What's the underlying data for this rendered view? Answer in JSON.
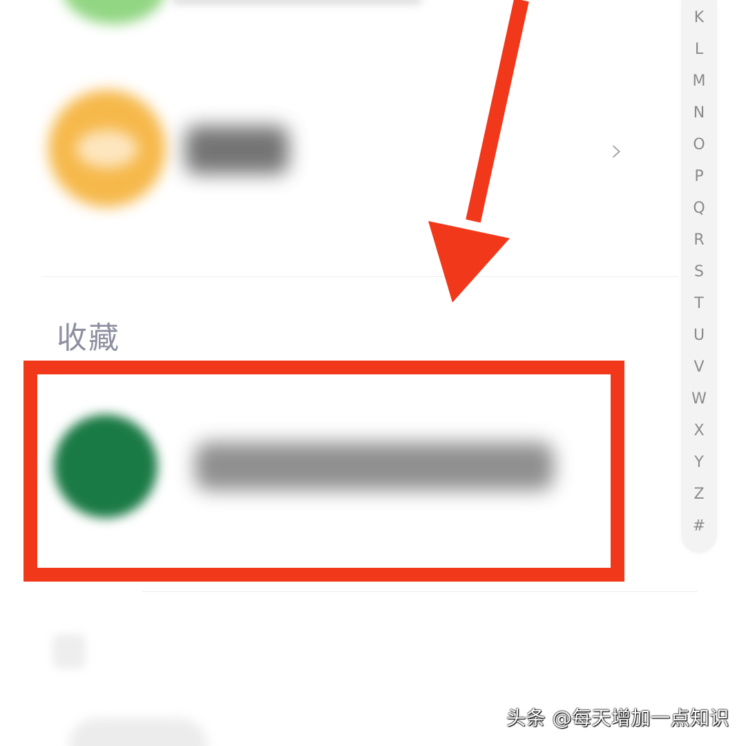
{
  "section": {
    "favorites_title": "收藏"
  },
  "rows": {
    "chevron_glyph": "›"
  },
  "alpha_index": [
    "K",
    "L",
    "M",
    "N",
    "O",
    "P",
    "Q",
    "R",
    "S",
    "T",
    "U",
    "V",
    "W",
    "X",
    "Y",
    "Z",
    "#"
  ],
  "annotation": {
    "arrow_color": "#f2381b",
    "box_color": "#f2381b"
  },
  "watermark": {
    "text": "头条 @每天增加一点知识"
  },
  "colors": {
    "avatar_top": "#7fcf6e",
    "avatar_orange": "#f6b84a",
    "avatar_green": "#1a7a45",
    "section_title": "#8e90a0"
  }
}
